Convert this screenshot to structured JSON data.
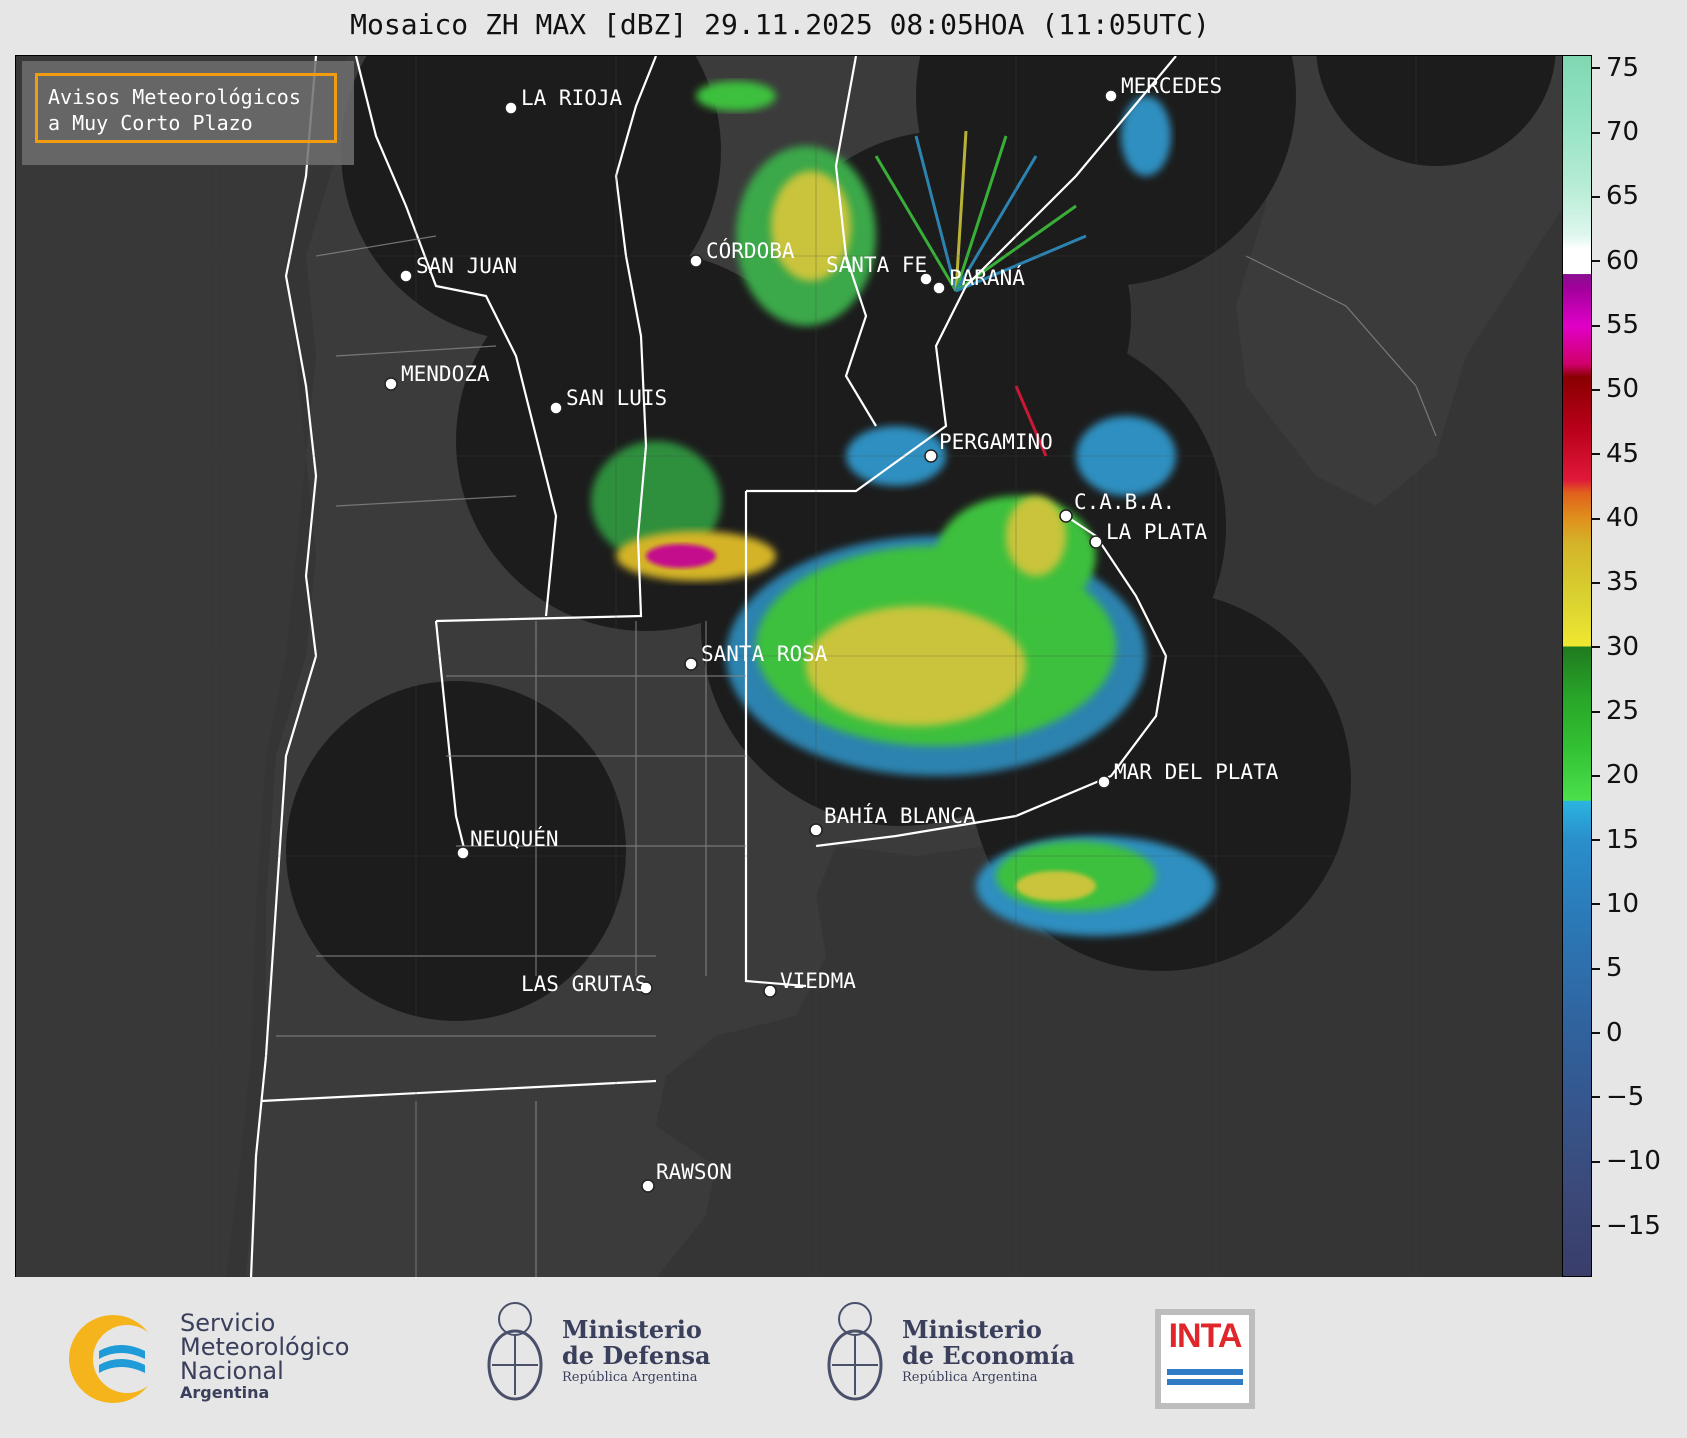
{
  "title": "Mosaico ZH MAX [dBZ] 29.11.2025 08:05HOA (11:05UTC)",
  "warning_box": {
    "line1": "Avisos Meteorológicos",
    "line2": "a Muy Corto Plazo"
  },
  "cities": [
    {
      "name": "LA RIOJA"
    },
    {
      "name": "MERCEDES"
    },
    {
      "name": "CÓRDOBA"
    },
    {
      "name": "SAN JUAN"
    },
    {
      "name": "SANTA FE"
    },
    {
      "name": "PARANÁ"
    },
    {
      "name": "MENDOZA"
    },
    {
      "name": "SAN LUIS"
    },
    {
      "name": "PERGAMINO"
    },
    {
      "name": "C.A.B.A."
    },
    {
      "name": "LA PLATA"
    },
    {
      "name": "SANTA ROSA"
    },
    {
      "name": "MAR DEL PLATA"
    },
    {
      "name": "BAHÍA BLANCA"
    },
    {
      "name": "NEUQUÉN"
    },
    {
      "name": "LAS GRUTAS"
    },
    {
      "name": "VIEDMA"
    },
    {
      "name": "RAWSON"
    }
  ],
  "colorbar": {
    "unit": "dBZ",
    "ticks": [
      "75",
      "70",
      "65",
      "60",
      "55",
      "50",
      "45",
      "40",
      "35",
      "30",
      "25",
      "20",
      "15",
      "10",
      "5",
      "0",
      "−5",
      "−10",
      "−15"
    ],
    "range": [
      -19,
      76
    ]
  },
  "footer": {
    "smn": {
      "line1": "Servicio",
      "line2": "Meteorológico",
      "line3": "Nacional",
      "line4": "Argentina"
    },
    "defensa": {
      "line1": "Ministerio",
      "line2": "de Defensa",
      "line3": "República Argentina"
    },
    "economia": {
      "line1": "Ministerio",
      "line2": "de Economía",
      "line3": "República Argentina"
    },
    "inta": {
      "label": "INTA"
    }
  }
}
